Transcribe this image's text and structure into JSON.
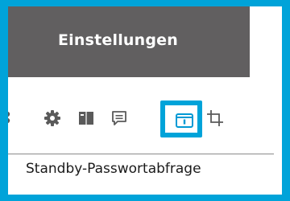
{
  "header": {
    "title": "Einstellungen"
  },
  "toolbar": {
    "buttons": [
      {
        "icon": "partial-icon"
      },
      {
        "icon": "gear-icon"
      },
      {
        "icon": "book-icon"
      },
      {
        "icon": "comment-icon"
      },
      {
        "icon": "standby-lock-icon",
        "highlighted": true
      },
      {
        "icon": "crop-icon"
      }
    ]
  },
  "tooltip": {
    "text": "Standby-Passwortabfrage"
  },
  "colors": {
    "accent": "#00a3d9",
    "header_bg": "#615f60",
    "icon": "#5a5a5a",
    "active_icon": "#0099d4"
  }
}
